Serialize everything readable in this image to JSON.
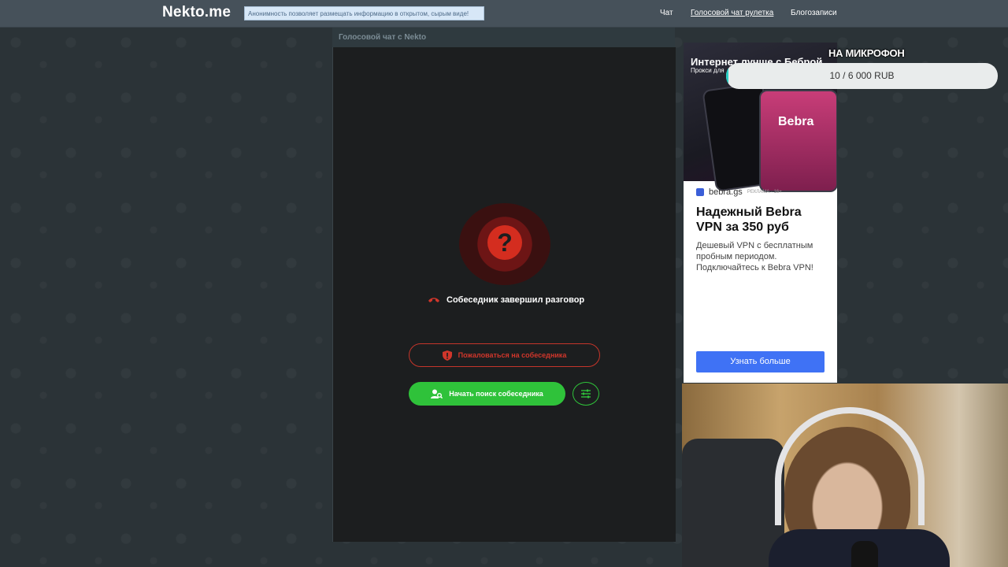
{
  "header": {
    "logo": "Nekto.me",
    "ticker": "Анонимность позволяет размещать информацию в открытом, сырым виде!",
    "nav": [
      {
        "label": "Чат"
      },
      {
        "label": "Голосовой чат рулетка"
      },
      {
        "label": "Блогозаписи"
      }
    ]
  },
  "chat": {
    "title": "Голосовой чат с Nekto",
    "status_symbol": "?",
    "ended_text": "Собеседник завершил разговор",
    "report_label": "Пожаловаться на собеседника",
    "search_label": "Начать поиск собеседника"
  },
  "ad": {
    "headline": "Интернет лучше с Беброй",
    "subline": "Прокси для",
    "phone_brand": "Bebra",
    "domain": "bebra.gs",
    "label": "РЕКЛАМА · 16+",
    "title": "Надежный Bebra VPN за 350 руб",
    "description": "Дешевый VPN с бесплатным пробным периодом. Подключайтесь к Bebra VPN!",
    "cta": "Узнать больше"
  },
  "donation": {
    "title": "НА МИКРОФОН",
    "progress_text": "10 / 6 000 RUB",
    "progress_fraction": 0.0017
  },
  "colors": {
    "accent_green": "#2fc23a",
    "alert_red": "#d42d1f",
    "ad_blue": "#3f72f5",
    "progress_teal": "#2ad1c6"
  }
}
